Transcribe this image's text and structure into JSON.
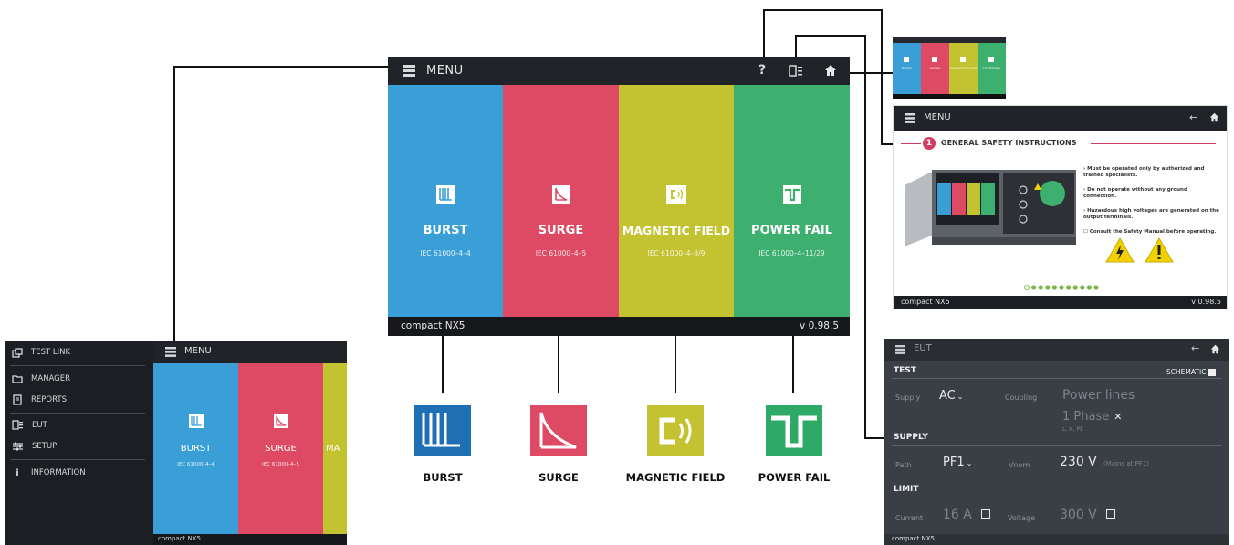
{
  "main": {
    "menu_label": "MENU",
    "help_icon": "?",
    "footer_brand": "compact NX5",
    "footer_version": "v 0.98.5",
    "tiles": [
      {
        "name": "BURST",
        "standard": "IEC 61000–4–4",
        "color": "#3a9fd6"
      },
      {
        "name": "SURGE",
        "standard": "IEC 61000–4–5",
        "color": "#de4a63"
      },
      {
        "name": "MAGNETIC FIELD",
        "standard": "IEC 61000–4–8/9",
        "color": "#c3c230"
      },
      {
        "name": "POWER FAIL",
        "standard": "IEC 61000–4–11/29",
        "color": "#3db06f"
      }
    ]
  },
  "callouts": [
    {
      "label": "BURST",
      "color": "#1f6fb5"
    },
    {
      "label": "SURGE",
      "color": "#de4a63"
    },
    {
      "label": "MAGNETIC FIELD",
      "color": "#c3c230"
    },
    {
      "label": "POWER FAIL",
      "color": "#2eaa66"
    }
  ],
  "left_screen": {
    "menu_label": "MENU",
    "footer_brand": "compact NX5",
    "sidebar": [
      {
        "label": "TEST LINK",
        "icon": "link-icon"
      },
      {
        "label": "MANAGER",
        "icon": "folder-icon"
      },
      {
        "label": "REPORTS",
        "icon": "report-icon"
      },
      {
        "label": "EUT",
        "icon": "eut-icon"
      },
      {
        "label": "SETUP",
        "icon": "setup-icon"
      },
      {
        "label": "INFORMATION",
        "icon": "info-icon"
      }
    ],
    "tiles": [
      {
        "name": "BURST",
        "standard": "IEC 61000–4–4"
      },
      {
        "name": "SURGE",
        "standard": "IEC 61000–4–5"
      },
      {
        "name": "MA",
        "standard": ""
      }
    ]
  },
  "safety_screen": {
    "menu_label": "MENU",
    "title_num": "1",
    "title": "GENERAL SAFETY INSTRUCTIONS",
    "bullets": [
      "› Must be operated only by authorized and trained specialists.",
      "› Do not operate without any ground connection.",
      "› Hazardous high voltages are generated on the output terminals.",
      "☐ Consult the Safety Manual before operating."
    ],
    "footer_brand": "compact NX5",
    "footer_version": "v 0.98.5",
    "page_count": 11,
    "current_page": 0
  },
  "eut_screen": {
    "title": "EUT",
    "test_label": "TEST",
    "schematic_label": "SCHEMATIC",
    "supply_field_label": "Supply",
    "supply_value": "AC",
    "coupling_label": "Coupling",
    "coupling_value": "Power lines",
    "phase_value": "1 Phase",
    "phase_sub": "L, N, PE",
    "supply_section": "SUPPLY",
    "path_label": "Path",
    "path_value": "PF1",
    "vnom_label": "Vnom",
    "vnom_value": "230 V",
    "vnom_note": "(Mains at PF1)",
    "limit_section": "LIMIT",
    "current_label": "Current",
    "current_value": "16 A",
    "voltage_label": "Voltage",
    "voltage_value": "300 V",
    "footer_brand": "compact NX5"
  },
  "thumb_screen": {
    "tiles": [
      {
        "name": "BURST",
        "color": "#3a9fd6"
      },
      {
        "name": "SURGE",
        "color": "#de4a63"
      },
      {
        "name": "MAGNETIC FIELD",
        "color": "#c3c230"
      },
      {
        "name": "POWERFAIL",
        "color": "#3db06f"
      }
    ]
  }
}
